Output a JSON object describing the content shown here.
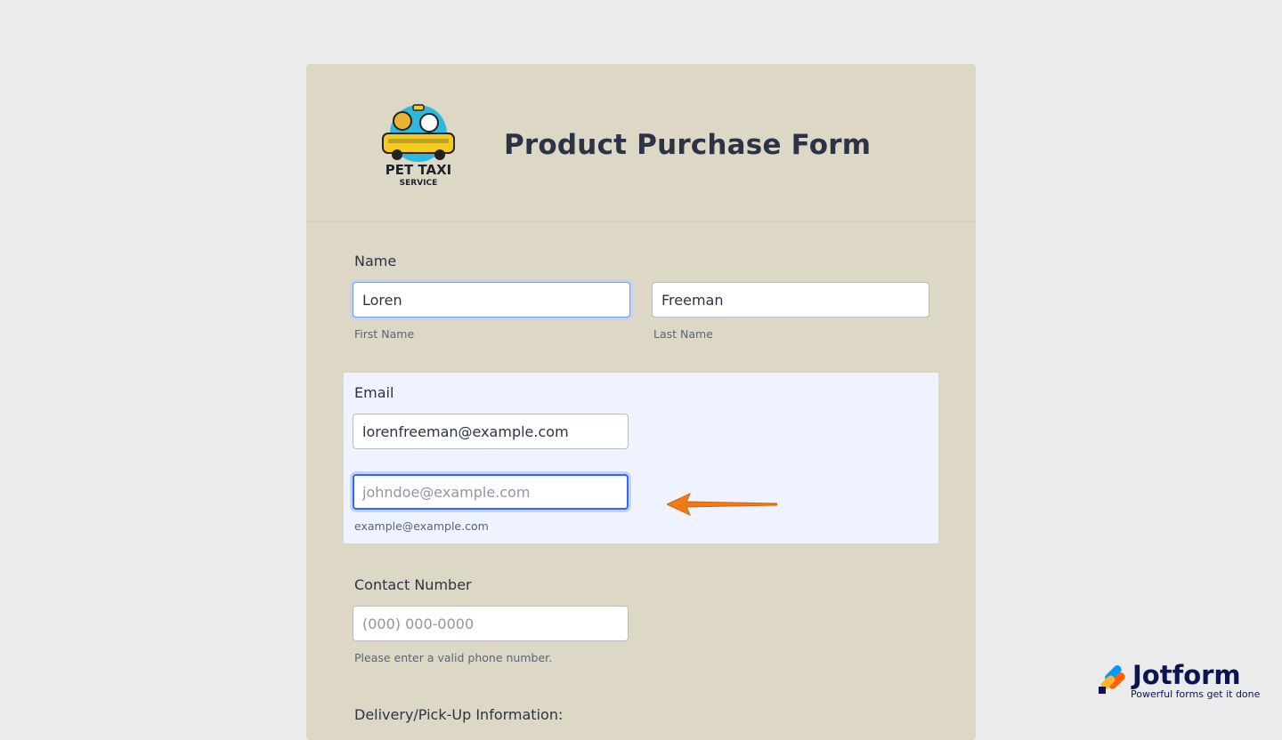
{
  "form": {
    "title": "Product Purchase Form",
    "logo": {
      "line1": "PET TAXI",
      "line2": "SERVICE"
    }
  },
  "name_field": {
    "label": "Name",
    "first": {
      "value": "Loren",
      "sublabel": "First Name"
    },
    "last": {
      "value": "Freeman",
      "sublabel": "Last Name"
    }
  },
  "email_field": {
    "label": "Email",
    "value": "lorenfreeman@example.com",
    "confirm_placeholder": "johndoe@example.com",
    "sublabel": "example@example.com"
  },
  "contact_field": {
    "label": "Contact Number",
    "placeholder": "(000) 000-0000",
    "sublabel": "Please enter a valid phone number."
  },
  "delivery_section": {
    "label": "Delivery/Pick-Up Information:"
  },
  "badge": {
    "name": "Jotform",
    "tagline": "Powerful forms get it done",
    "icon": "jotform-logo-icon"
  },
  "colors": {
    "form_bg": "#ddd8c6",
    "page_bg": "#ebebeb",
    "highlight_bg": "#eef3ff",
    "focus_blue": "#2e69ff",
    "arrow": "#f07a14"
  }
}
